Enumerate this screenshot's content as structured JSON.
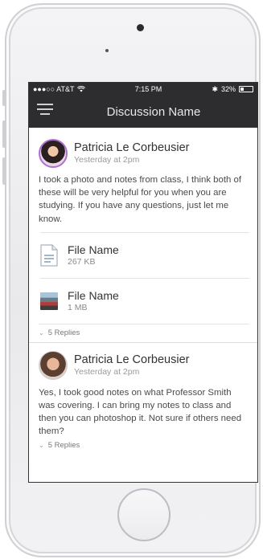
{
  "status_bar": {
    "carrier": "●●●○○ AT&T",
    "time": "7:15 PM",
    "bluetooth": "✱",
    "battery_text": "32%",
    "battery_level": 0.32
  },
  "nav": {
    "title": "Discussion Name",
    "menu_icon": "hamburger-icon"
  },
  "posts": [
    {
      "author": "Patricia Le Corbeusier",
      "timestamp": "Yesterday at 2pm",
      "text": "I took a photo and notes from class, I think both of these will be very helpful for you when you are studying.  If you have any questions, just let me know.",
      "files": [
        {
          "name": "File Name",
          "size": "267 KB",
          "icon": "document-icon"
        },
        {
          "name": "File Name",
          "size": "1 MB",
          "icon": "photo-thumbnail"
        }
      ],
      "replies": "5 Replies"
    },
    {
      "author": "Patricia Le Corbeusier",
      "timestamp": "Yesterday at 2pm",
      "text": "Yes, I took good notes on what Professor Smith was covering.  I can bring my notes to class and then you can photoshop it. Not sure if others need them?",
      "replies": "5 Replies"
    }
  ],
  "colors": {
    "nav_bg": "#2d2d2f",
    "avatar_ring": "#b06fd1"
  }
}
